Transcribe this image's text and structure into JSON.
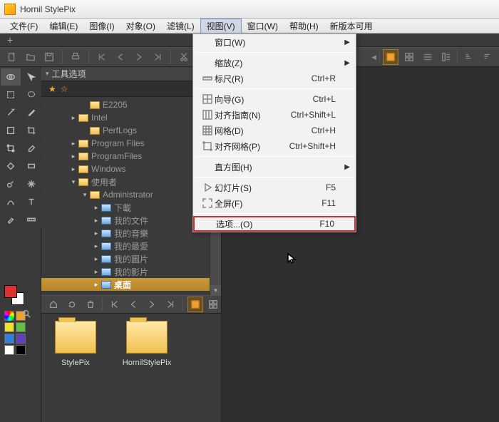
{
  "app": {
    "title": "Hornil StylePix"
  },
  "menubar": {
    "items": [
      {
        "label": "文件(F)"
      },
      {
        "label": "编辑(E)"
      },
      {
        "label": "图像(I)"
      },
      {
        "label": "对象(O)"
      },
      {
        "label": "滤镜(L)"
      },
      {
        "label": "视图(V)"
      },
      {
        "label": "窗口(W)"
      },
      {
        "label": "帮助(H)"
      },
      {
        "label": "新版本可用"
      }
    ],
    "open_index": 5
  },
  "dropdown": {
    "rows": [
      {
        "type": "item",
        "label": "窗口(W)",
        "shortcut": "",
        "submenu": true,
        "icon": ""
      },
      {
        "type": "sep"
      },
      {
        "type": "item",
        "label": "缩放(Z)",
        "shortcut": "",
        "submenu": true,
        "icon": ""
      },
      {
        "type": "item",
        "label": "标尺(R)",
        "shortcut": "Ctrl+R",
        "submenu": false,
        "icon": "ruler"
      },
      {
        "type": "sep"
      },
      {
        "type": "item",
        "label": "向导(G)",
        "shortcut": "Ctrl+L",
        "submenu": false,
        "icon": "guide"
      },
      {
        "type": "item",
        "label": "对齐指南(N)",
        "shortcut": "Ctrl+Shift+L",
        "submenu": false,
        "icon": "snapguide"
      },
      {
        "type": "item",
        "label": "网格(D)",
        "shortcut": "Ctrl+H",
        "submenu": false,
        "icon": "grid"
      },
      {
        "type": "item",
        "label": "对齐网格(P)",
        "shortcut": "Ctrl+Shift+H",
        "submenu": false,
        "icon": "snapgrid"
      },
      {
        "type": "sep"
      },
      {
        "type": "item",
        "label": "直方图(H)",
        "shortcut": "",
        "submenu": true,
        "icon": ""
      },
      {
        "type": "sep"
      },
      {
        "type": "item",
        "label": "幻灯片(S)",
        "shortcut": "F5",
        "submenu": false,
        "icon": "play"
      },
      {
        "type": "item",
        "label": "全屏(F)",
        "shortcut": "F11",
        "submenu": false,
        "icon": "fullscreen"
      },
      {
        "type": "sep"
      },
      {
        "type": "item",
        "label": "选项...(O)",
        "shortcut": "F10",
        "submenu": false,
        "icon": "",
        "highlight": true
      }
    ]
  },
  "panel": {
    "header": "工具选项"
  },
  "tree": {
    "nodes": [
      {
        "indent": 3,
        "caret": "",
        "icon": "fld",
        "label": "E2205"
      },
      {
        "indent": 2,
        "caret": "▸",
        "icon": "fld",
        "label": "Intel"
      },
      {
        "indent": 3,
        "caret": "",
        "icon": "fld",
        "label": "PerfLogs"
      },
      {
        "indent": 2,
        "caret": "▸",
        "icon": "fld",
        "label": "Program Files"
      },
      {
        "indent": 2,
        "caret": "▸",
        "icon": "fld",
        "label": "ProgramFiles"
      },
      {
        "indent": 2,
        "caret": "▸",
        "icon": "fld",
        "label": "Windows"
      },
      {
        "indent": 2,
        "caret": "▾",
        "icon": "fld",
        "label": "使用者"
      },
      {
        "indent": 3,
        "caret": "▾",
        "icon": "fld",
        "label": "Administrator"
      },
      {
        "indent": 4,
        "caret": "▸",
        "icon": "fld2",
        "label": "下載"
      },
      {
        "indent": 4,
        "caret": "▸",
        "icon": "fld2",
        "label": "我的文件"
      },
      {
        "indent": 4,
        "caret": "▸",
        "icon": "fld2",
        "label": "我的音樂"
      },
      {
        "indent": 4,
        "caret": "▸",
        "icon": "fld2",
        "label": "我的最愛"
      },
      {
        "indent": 4,
        "caret": "▸",
        "icon": "fld2",
        "label": "我的圖片"
      },
      {
        "indent": 4,
        "caret": "▸",
        "icon": "fld2",
        "label": "我的影片"
      },
      {
        "indent": 4,
        "caret": "▸",
        "icon": "fld2",
        "label": "桌面",
        "selected": true
      }
    ]
  },
  "files": {
    "items": [
      {
        "label": "HornilStylePix"
      },
      {
        "label": "StylePix"
      }
    ]
  },
  "swatches": [
    "#e03030",
    "#f0a030",
    "#f0e030",
    "#60c040",
    "#3080e0",
    "#6040c0",
    "#ffffff",
    "#000000"
  ]
}
